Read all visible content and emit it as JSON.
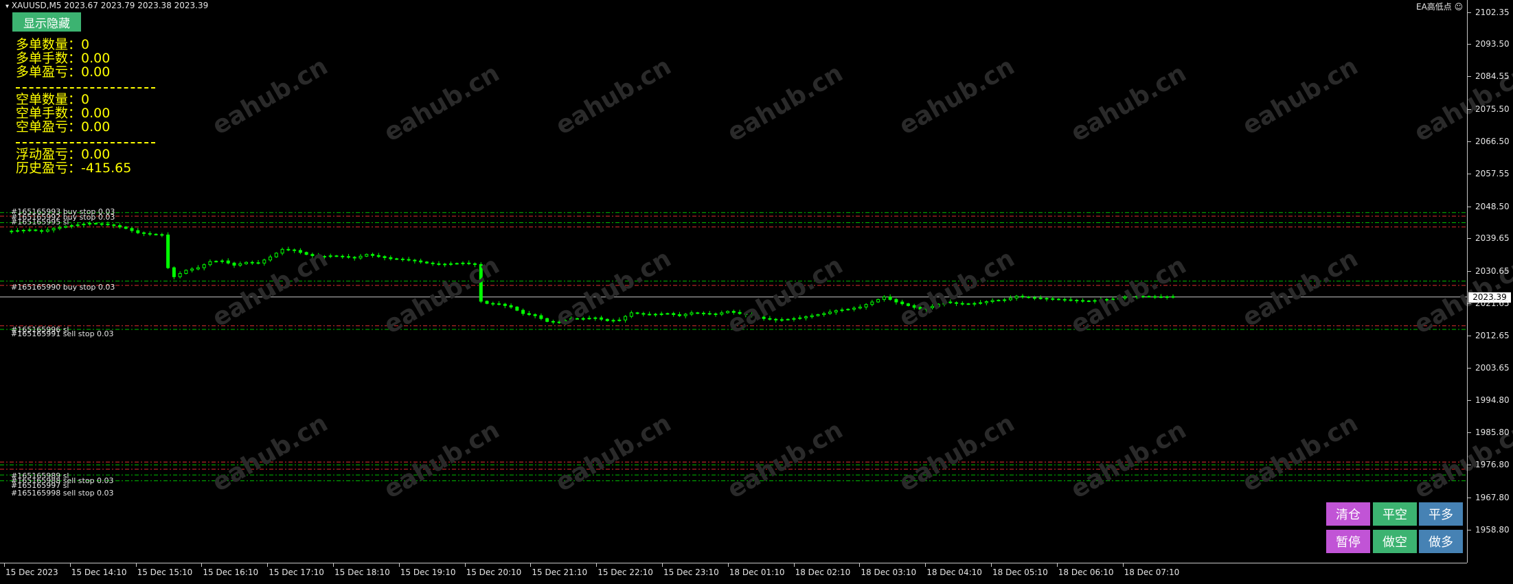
{
  "header": {
    "symbol_line": "XAUUSD,M5  2023.67 2023.79 2023.38 2023.39",
    "ea_label": "EA高低点 ☺"
  },
  "panel": {
    "toggle_button": "显示隐藏",
    "long_count_label": "多单数量：",
    "long_count": "0",
    "long_lots_label": "多单手数：",
    "long_lots": "0.00",
    "long_pnl_label": "多单盈亏：",
    "long_pnl": "0.00",
    "short_count_label": "空单数量：",
    "short_count": "0",
    "short_lots_label": "空单手数：",
    "short_lots": "0.00",
    "short_pnl_label": "空单盈亏：",
    "short_pnl": "0.00",
    "floating_pnl_label": "浮动盈亏：",
    "floating_pnl": "0.00",
    "history_pnl_label": "历史盈亏：",
    "history_pnl": "-415.65"
  },
  "controls": {
    "close_all": "清仓",
    "close_short": "平空",
    "close_long": "平多",
    "pause": "暂停",
    "sell": "做空",
    "buy": "做多",
    "colors": {
      "purple": "#c154d6",
      "green": "#3cb371",
      "blue": "#4682b4"
    }
  },
  "order_labels": [
    "#165165993 buy stop 0.03",
    "#165165992 buy stop 0.03",
    "#165165995 sl",
    "#165165990 buy stop 0.03",
    "#165165996 sl",
    "#165165991 sell stop 0.03",
    "#165165989 sl",
    "#165165988 sell stop 0.03",
    "#165165997 sl",
    "#165165998 sell stop 0.03"
  ],
  "price_scale": {
    "ticks": [
      "2102.35",
      "2093.50",
      "2084.55",
      "2075.50",
      "2066.50",
      "2057.55",
      "2048.50",
      "2039.65",
      "2030.65",
      "2021.65",
      "2012.65",
      "2003.65",
      "1994.80",
      "1985.80",
      "1976.80",
      "1967.80",
      "1958.80"
    ],
    "current_price": "2023.39"
  },
  "time_scale": {
    "labels": [
      "15 Dec 2023",
      "15 Dec 14:10",
      "15 Dec 15:10",
      "15 Dec 16:10",
      "15 Dec 17:10",
      "15 Dec 18:10",
      "15 Dec 19:10",
      "15 Dec 20:10",
      "15 Dec 21:10",
      "15 Dec 22:10",
      "15 Dec 23:10",
      "18 Dec 01:10",
      "18 Dec 02:10",
      "18 Dec 03:10",
      "18 Dec 04:10",
      "18 Dec 05:10",
      "18 Dec 06:10",
      "18 Dec 07:10"
    ]
  },
  "watermark": "eahub.cn",
  "colors": {
    "background": "#000000",
    "candle": "#00ff00",
    "stat_text": "#ffff00",
    "buy_line": "#00c000",
    "sell_line": "#e03030"
  },
  "chart_data": {
    "type": "candlestick",
    "symbol": "XAUUSD",
    "timeframe": "M5",
    "ohlc_last": {
      "open": 2023.67,
      "high": 2023.79,
      "low": 2023.38,
      "close": 2023.39
    },
    "ylim": [
      1954.0,
      2106.0
    ],
    "x": [
      "15 Dec 2023",
      "15 Dec 14:10",
      "15 Dec 15:10",
      "15 Dec 16:10",
      "15 Dec 17:10",
      "15 Dec 18:10",
      "15 Dec 19:10",
      "15 Dec 20:10",
      "15 Dec 21:10",
      "15 Dec 22:10",
      "15 Dec 23:10",
      "18 Dec 01:10",
      "18 Dec 02:10",
      "18 Dec 03:10",
      "18 Dec 04:10",
      "18 Dec 05:10",
      "18 Dec 06:10",
      "18 Dec 07:10"
    ],
    "close_path": [
      [
        0,
        2041.5
      ],
      [
        2,
        2041.8
      ],
      [
        4,
        2042.0
      ],
      [
        6,
        2041.6
      ],
      [
        8,
        2042.4
      ],
      [
        10,
        2043.0
      ],
      [
        12,
        2043.4
      ],
      [
        14,
        2043.8
      ],
      [
        16,
        2043.6
      ],
      [
        18,
        2043.2
      ],
      [
        20,
        2042.4
      ],
      [
        22,
        2041.2
      ],
      [
        24,
        2040.8
      ],
      [
        26,
        2040.6
      ],
      [
        27,
        2031.5
      ],
      [
        28,
        2029.0
      ],
      [
        30,
        2030.8
      ],
      [
        32,
        2031.5
      ],
      [
        34,
        2033.2
      ],
      [
        36,
        2033.4
      ],
      [
        38,
        2032.2
      ],
      [
        40,
        2033.0
      ],
      [
        42,
        2032.8
      ],
      [
        44,
        2034.5
      ],
      [
        46,
        2036.6
      ],
      [
        48,
        2036.3
      ],
      [
        50,
        2035.2
      ],
      [
        52,
        2034.5
      ],
      [
        54,
        2034.8
      ],
      [
        56,
        2034.6
      ],
      [
        58,
        2034.2
      ],
      [
        60,
        2035.2
      ],
      [
        62,
        2034.6
      ],
      [
        64,
        2034.0
      ],
      [
        66,
        2033.8
      ],
      [
        68,
        2033.4
      ],
      [
        70,
        2032.8
      ],
      [
        72,
        2032.4
      ],
      [
        74,
        2032.6
      ],
      [
        76,
        2032.8
      ],
      [
        78,
        2032.4
      ],
      [
        79,
        2022.2
      ],
      [
        80,
        2021.6
      ],
      [
        82,
        2021.4
      ],
      [
        84,
        2020.6
      ],
      [
        86,
        2018.8
      ],
      [
        88,
        2018.2
      ],
      [
        90,
        2016.6
      ],
      [
        92,
        2016.3
      ],
      [
        94,
        2017.4
      ],
      [
        96,
        2017.4
      ],
      [
        98,
        2017.6
      ],
      [
        100,
        2016.8
      ],
      [
        102,
        2017.0
      ],
      [
        104,
        2019.0
      ],
      [
        106,
        2018.6
      ],
      [
        108,
        2018.6
      ],
      [
        110,
        2018.8
      ],
      [
        112,
        2018.2
      ],
      [
        114,
        2019.0
      ],
      [
        116,
        2018.8
      ],
      [
        118,
        2018.6
      ],
      [
        120,
        2019.4
      ],
      [
        122,
        2018.8
      ],
      [
        124,
        2018.2
      ],
      [
        126,
        2017.4
      ],
      [
        128,
        2017.0
      ],
      [
        130,
        2017.2
      ],
      [
        132,
        2017.6
      ],
      [
        134,
        2018.2
      ],
      [
        136,
        2018.8
      ],
      [
        138,
        2019.6
      ],
      [
        140,
        2020.0
      ],
      [
        142,
        2020.6
      ],
      [
        144,
        2022.0
      ],
      [
        146,
        2023.4
      ],
      [
        148,
        2022.0
      ],
      [
        150,
        2021.0
      ],
      [
        152,
        2020.0
      ],
      [
        154,
        2020.8
      ],
      [
        156,
        2022.0
      ],
      [
        158,
        2021.6
      ],
      [
        160,
        2021.4
      ],
      [
        162,
        2021.8
      ],
      [
        164,
        2022.4
      ],
      [
        166,
        2022.6
      ],
      [
        168,
        2023.6
      ],
      [
        170,
        2023.2
      ],
      [
        172,
        2023.0
      ],
      [
        174,
        2022.8
      ],
      [
        176,
        2022.6
      ],
      [
        178,
        2022.4
      ],
      [
        180,
        2022.2
      ],
      [
        182,
        2022.6
      ],
      [
        184,
        2022.8
      ],
      [
        186,
        2023.4
      ],
      [
        188,
        2023.6
      ],
      [
        190,
        2023.5
      ],
      [
        192,
        2023.4
      ],
      [
        194,
        2023.5
      ]
    ],
    "order_lines": [
      {
        "price": 2046.8,
        "kind": "buy stop",
        "color": "green"
      },
      {
        "price": 2045.8,
        "kind": "sl",
        "color": "red"
      },
      {
        "price": 2044.0,
        "kind": "buy stop",
        "color": "green"
      },
      {
        "price": 2042.8,
        "kind": "sl",
        "color": "red"
      },
      {
        "price": 2027.8,
        "kind": "buy stop",
        "color": "green"
      },
      {
        "price": 2026.6,
        "kind": "sl",
        "color": "red"
      },
      {
        "price": 2015.4,
        "kind": "sl",
        "color": "red"
      },
      {
        "price": 2014.4,
        "kind": "sell stop",
        "color": "green"
      },
      {
        "price": 1977.6,
        "kind": "sl",
        "color": "red"
      },
      {
        "price": 1976.8,
        "kind": "sell stop",
        "color": "green"
      },
      {
        "price": 1975.6,
        "kind": "sl",
        "color": "red"
      },
      {
        "price": 1974.0,
        "kind": "sell stop",
        "color": "green"
      },
      {
        "price": 1972.4,
        "kind": "sell stop",
        "color": "green"
      }
    ],
    "current_price_line": 2023.39
  }
}
